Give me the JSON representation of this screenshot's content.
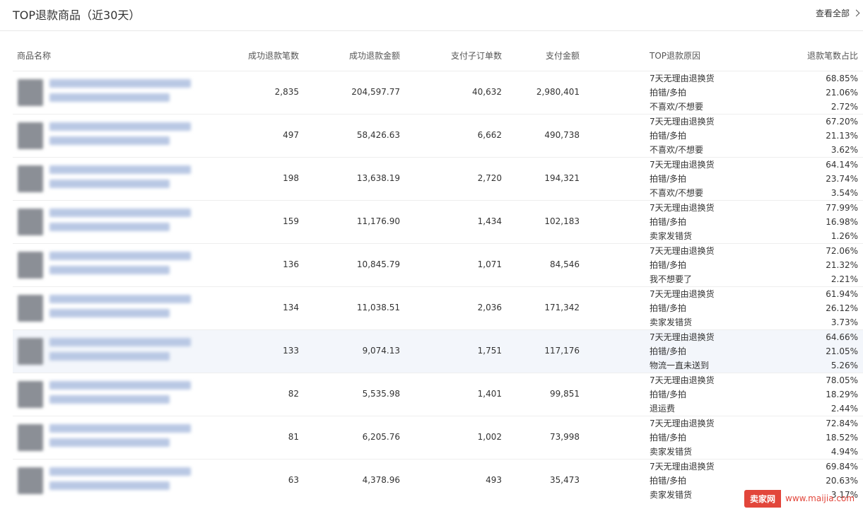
{
  "header": {
    "title": "TOP退款商品（近30天）",
    "view_all": "查看全部"
  },
  "columns": {
    "name": "商品名称",
    "refund_count": "成功退款笔数",
    "refund_amount": "成功退款金额",
    "sub_orders": "支付子订单数",
    "pay_amount": "支付金额",
    "top_reasons": "TOP退款原因",
    "ratio": "退款笔数占比"
  },
  "rows": [
    {
      "refund_count": "2,835",
      "refund_amount": "204,597.77",
      "sub_orders": "40,632",
      "pay_amount": "2,980,401",
      "reasons": [
        {
          "name": "7天无理由退换货",
          "pct": "68.85%"
        },
        {
          "name": "拍错/多拍",
          "pct": "21.06%"
        },
        {
          "name": "不喜欢/不想要",
          "pct": "2.72%"
        }
      ]
    },
    {
      "refund_count": "497",
      "refund_amount": "58,426.63",
      "sub_orders": "6,662",
      "pay_amount": "490,738",
      "reasons": [
        {
          "name": "7天无理由退换货",
          "pct": "67.20%"
        },
        {
          "name": "拍错/多拍",
          "pct": "21.13%"
        },
        {
          "name": "不喜欢/不想要",
          "pct": "3.62%"
        }
      ]
    },
    {
      "refund_count": "198",
      "refund_amount": "13,638.19",
      "sub_orders": "2,720",
      "pay_amount": "194,321",
      "reasons": [
        {
          "name": "7天无理由退换货",
          "pct": "64.14%"
        },
        {
          "name": "拍错/多拍",
          "pct": "23.74%"
        },
        {
          "name": "不喜欢/不想要",
          "pct": "3.54%"
        }
      ]
    },
    {
      "refund_count": "159",
      "refund_amount": "11,176.90",
      "sub_orders": "1,434",
      "pay_amount": "102,183",
      "reasons": [
        {
          "name": "7天无理由退换货",
          "pct": "77.99%"
        },
        {
          "name": "拍错/多拍",
          "pct": "16.98%"
        },
        {
          "name": "卖家发错货",
          "pct": "1.26%"
        }
      ]
    },
    {
      "refund_count": "136",
      "refund_amount": "10,845.79",
      "sub_orders": "1,071",
      "pay_amount": "84,546",
      "reasons": [
        {
          "name": "7天无理由退换货",
          "pct": "72.06%"
        },
        {
          "name": "拍错/多拍",
          "pct": "21.32%"
        },
        {
          "name": "我不想要了",
          "pct": "2.21%"
        }
      ]
    },
    {
      "refund_count": "134",
      "refund_amount": "11,038.51",
      "sub_orders": "2,036",
      "pay_amount": "171,342",
      "reasons": [
        {
          "name": "7天无理由退换货",
          "pct": "61.94%"
        },
        {
          "name": "拍错/多拍",
          "pct": "26.12%"
        },
        {
          "name": "卖家发错货",
          "pct": "3.73%"
        }
      ]
    },
    {
      "refund_count": "133",
      "refund_amount": "9,074.13",
      "sub_orders": "1,751",
      "pay_amount": "117,176",
      "reasons": [
        {
          "name": "7天无理由退换货",
          "pct": "64.66%"
        },
        {
          "name": "拍错/多拍",
          "pct": "21.05%"
        },
        {
          "name": "物流一直未送到",
          "pct": "5.26%"
        }
      ]
    },
    {
      "refund_count": "82",
      "refund_amount": "5,535.98",
      "sub_orders": "1,401",
      "pay_amount": "99,851",
      "reasons": [
        {
          "name": "7天无理由退换货",
          "pct": "78.05%"
        },
        {
          "name": "拍错/多拍",
          "pct": "18.29%"
        },
        {
          "name": "退运费",
          "pct": "2.44%"
        }
      ]
    },
    {
      "refund_count": "81",
      "refund_amount": "6,205.76",
      "sub_orders": "1,002",
      "pay_amount": "73,998",
      "reasons": [
        {
          "name": "7天无理由退换货",
          "pct": "72.84%"
        },
        {
          "name": "拍错/多拍",
          "pct": "18.52%"
        },
        {
          "name": "卖家发错货",
          "pct": "4.94%"
        }
      ]
    },
    {
      "refund_count": "63",
      "refund_amount": "4,378.96",
      "sub_orders": "493",
      "pay_amount": "35,473",
      "reasons": [
        {
          "name": "7天无理由退换货",
          "pct": "69.84%"
        },
        {
          "name": "拍错/多拍",
          "pct": "20.63%"
        },
        {
          "name": "卖家发错货",
          "pct": "3.17%"
        }
      ]
    }
  ],
  "watermark": {
    "logo": "卖家网",
    "url": "www.maijia.com"
  }
}
